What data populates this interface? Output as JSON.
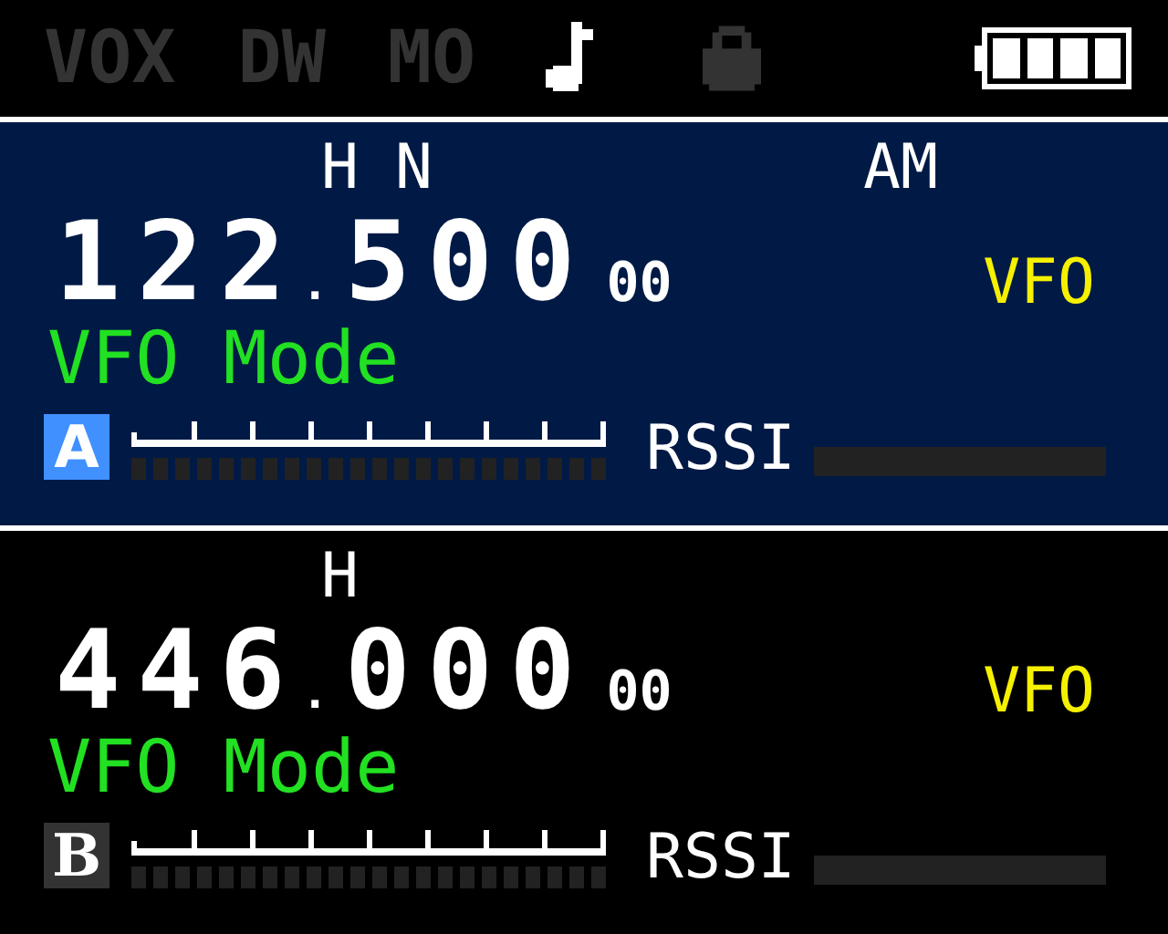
{
  "status_bar": {
    "indicators": [
      {
        "kind": "text",
        "label": "VOX",
        "on": false
      },
      {
        "kind": "text",
        "label": "DW",
        "on": false
      },
      {
        "kind": "text",
        "label": "MO",
        "on": false
      },
      {
        "kind": "note",
        "on": true
      },
      {
        "kind": "lock",
        "on": false
      }
    ]
  },
  "channels": [
    {
      "label": "A",
      "selected": true,
      "power": "H",
      "mode": "N",
      "modulation": "AM",
      "frequency": "122.500",
      "sub_frequency": "00",
      "mem": "VFO",
      "name": "VFO Mode",
      "smeter": {
        "level": 0
      },
      "rssi_label": "RSSI",
      "rssi": {
        "level": 0
      }
    },
    {
      "label": "B",
      "selected": false,
      "power": "H",
      "frequency": "446.000",
      "sub_frequency": "00",
      "mem": "VFO",
      "name": "VFO Mode",
      "smeter": {
        "level": 0
      },
      "rssi_label": "RSSI",
      "rssi": {
        "level": 0
      }
    }
  ]
}
